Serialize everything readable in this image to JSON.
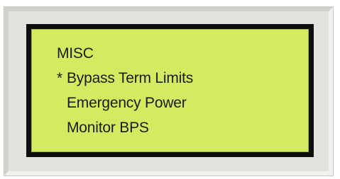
{
  "lcd_menu": {
    "title": "MISC",
    "cursor": "*",
    "options": [
      "Bypass Term Limits",
      "Emergency Power",
      "Monitor BPS"
    ],
    "colors": {
      "screen_background": "#d4ea61",
      "text": "#1b1b10",
      "frame": "#0e0e0e",
      "bezel": "#e3e3dd"
    }
  }
}
